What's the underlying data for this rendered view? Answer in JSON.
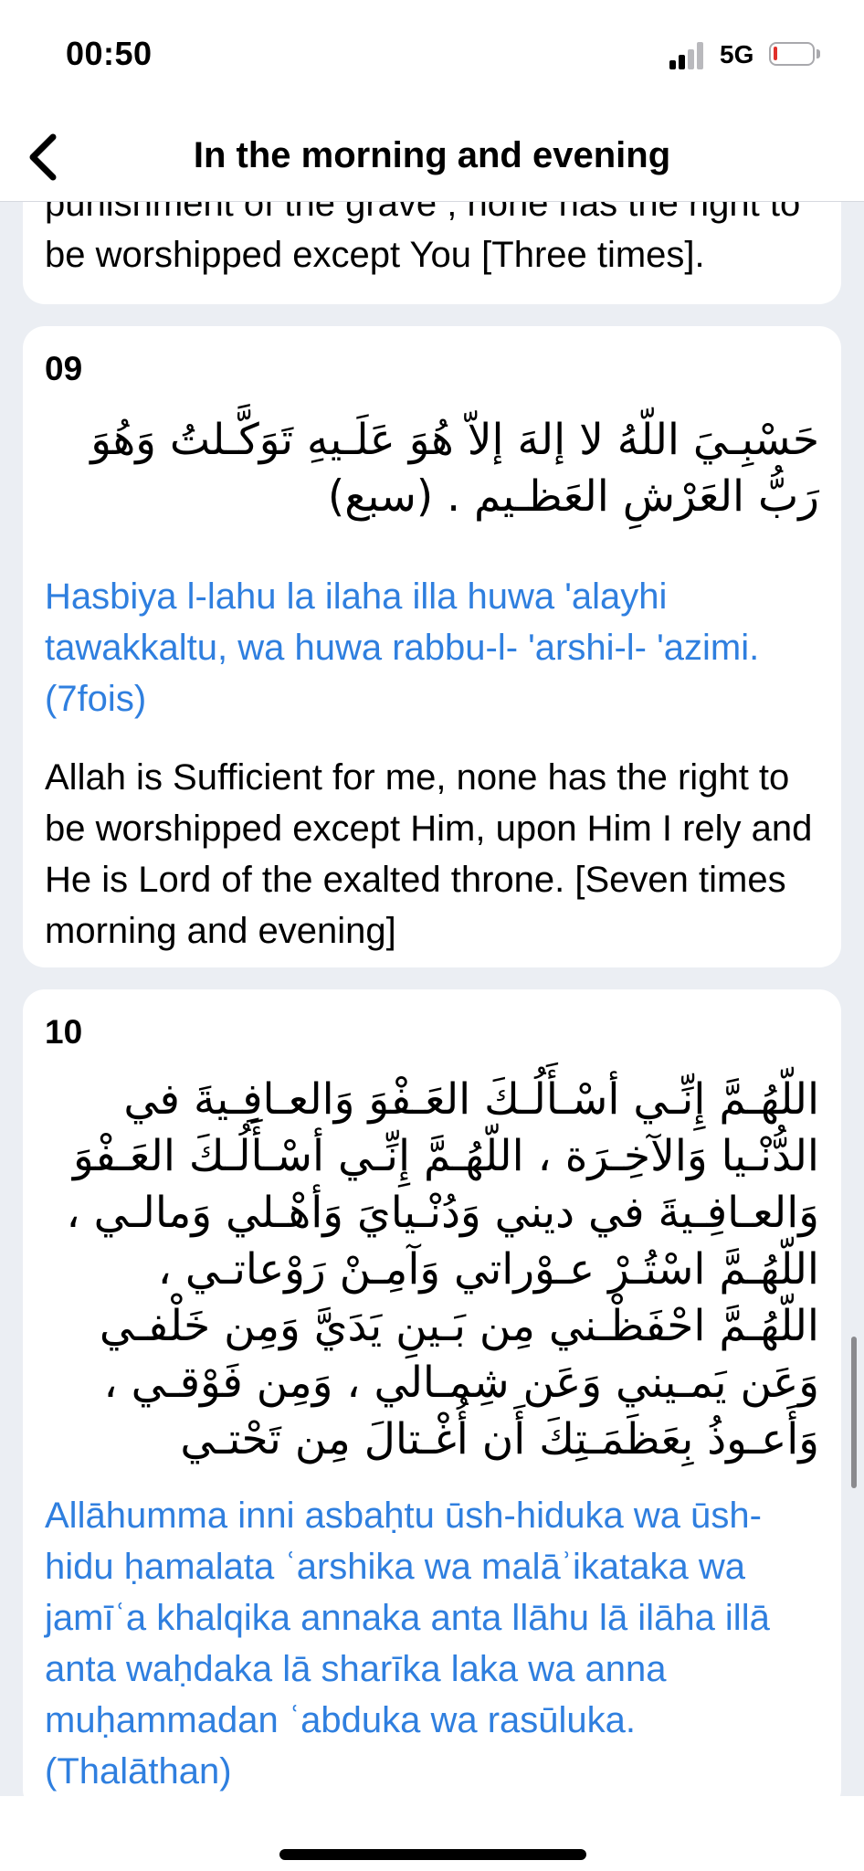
{
  "status_bar": {
    "time": "00:50",
    "network": "5G"
  },
  "nav": {
    "title": "In the morning and evening",
    "back_icon": "chevron-left-icon"
  },
  "cards": [
    {
      "number": "",
      "translation": "punishment of the grave ; none has the right to be worshipped except You [Three times]."
    },
    {
      "number": "09",
      "arabic": "حَسْبِـيَ اللّهُ لا إلهَ إلاّ هُوَ عَلَـيهِ تَوَكَّـلتُ وَهُوَ رَبُّ العَرْشِ العَظـيم . (سبع)",
      "transliteration": "Hasbiya l-lahu la ilaha illa huwa 'alayhi tawakkaltu, wa huwa rabbu-l- 'arshi-l- 'azimi. (7fois)",
      "translation": "Allah is Sufficient for me, none has the right to be worshipped except Him, upon Him I rely and He is Lord of the exalted throne. [Seven times morning and evening]"
    },
    {
      "number": "10",
      "arabic": "اللّهُـمَّ إِنِّـي أسْـأَلُـكَ العَـفْوَ وَالعـافِـيةَ في الدُّنْـيا وَالآخِـرَة ، اللّهُـمَّ إِنِّـي أسْـأَلُـكَ العَـفْوَ وَالعـافِـيةَ في ديني وَدُنْـيايَ وَأهْـلي وَمالـي ، اللّهُـمَّ اسْتُـرْ عـوْراتي وَآمِـنْ رَوْعاتـي ، اللّهُـمَّ احْفَظْـني مِن بَـينِ يَدَيَّ وَمِن خَلْفـي وَعَن يَمـيني وَعَن شِمـالي ، وَمِن فَوْقـي ، وَأَعـوذُ بِعَظَمَـتِكَ أَن أُغْـتالَ مِن تَحْتـي",
      "transliteration": "Allāhumma inni asbaḥtu ūsh-hiduka wa ūsh-hidu ḥamalata ʿarshika wa malāʾikataka wa jamīʿa khalqika annaka anta llāhu lā ilāha illā anta waḥdaka lā sharīka laka wa anna muḥammadan ʿabduka wa rasūluka. (Thalāthan)"
    }
  ],
  "colors": {
    "background": "#ebeef3",
    "card": "#ffffff",
    "transliteration": "#2f7fdf",
    "battery_level": "#e0302a"
  }
}
